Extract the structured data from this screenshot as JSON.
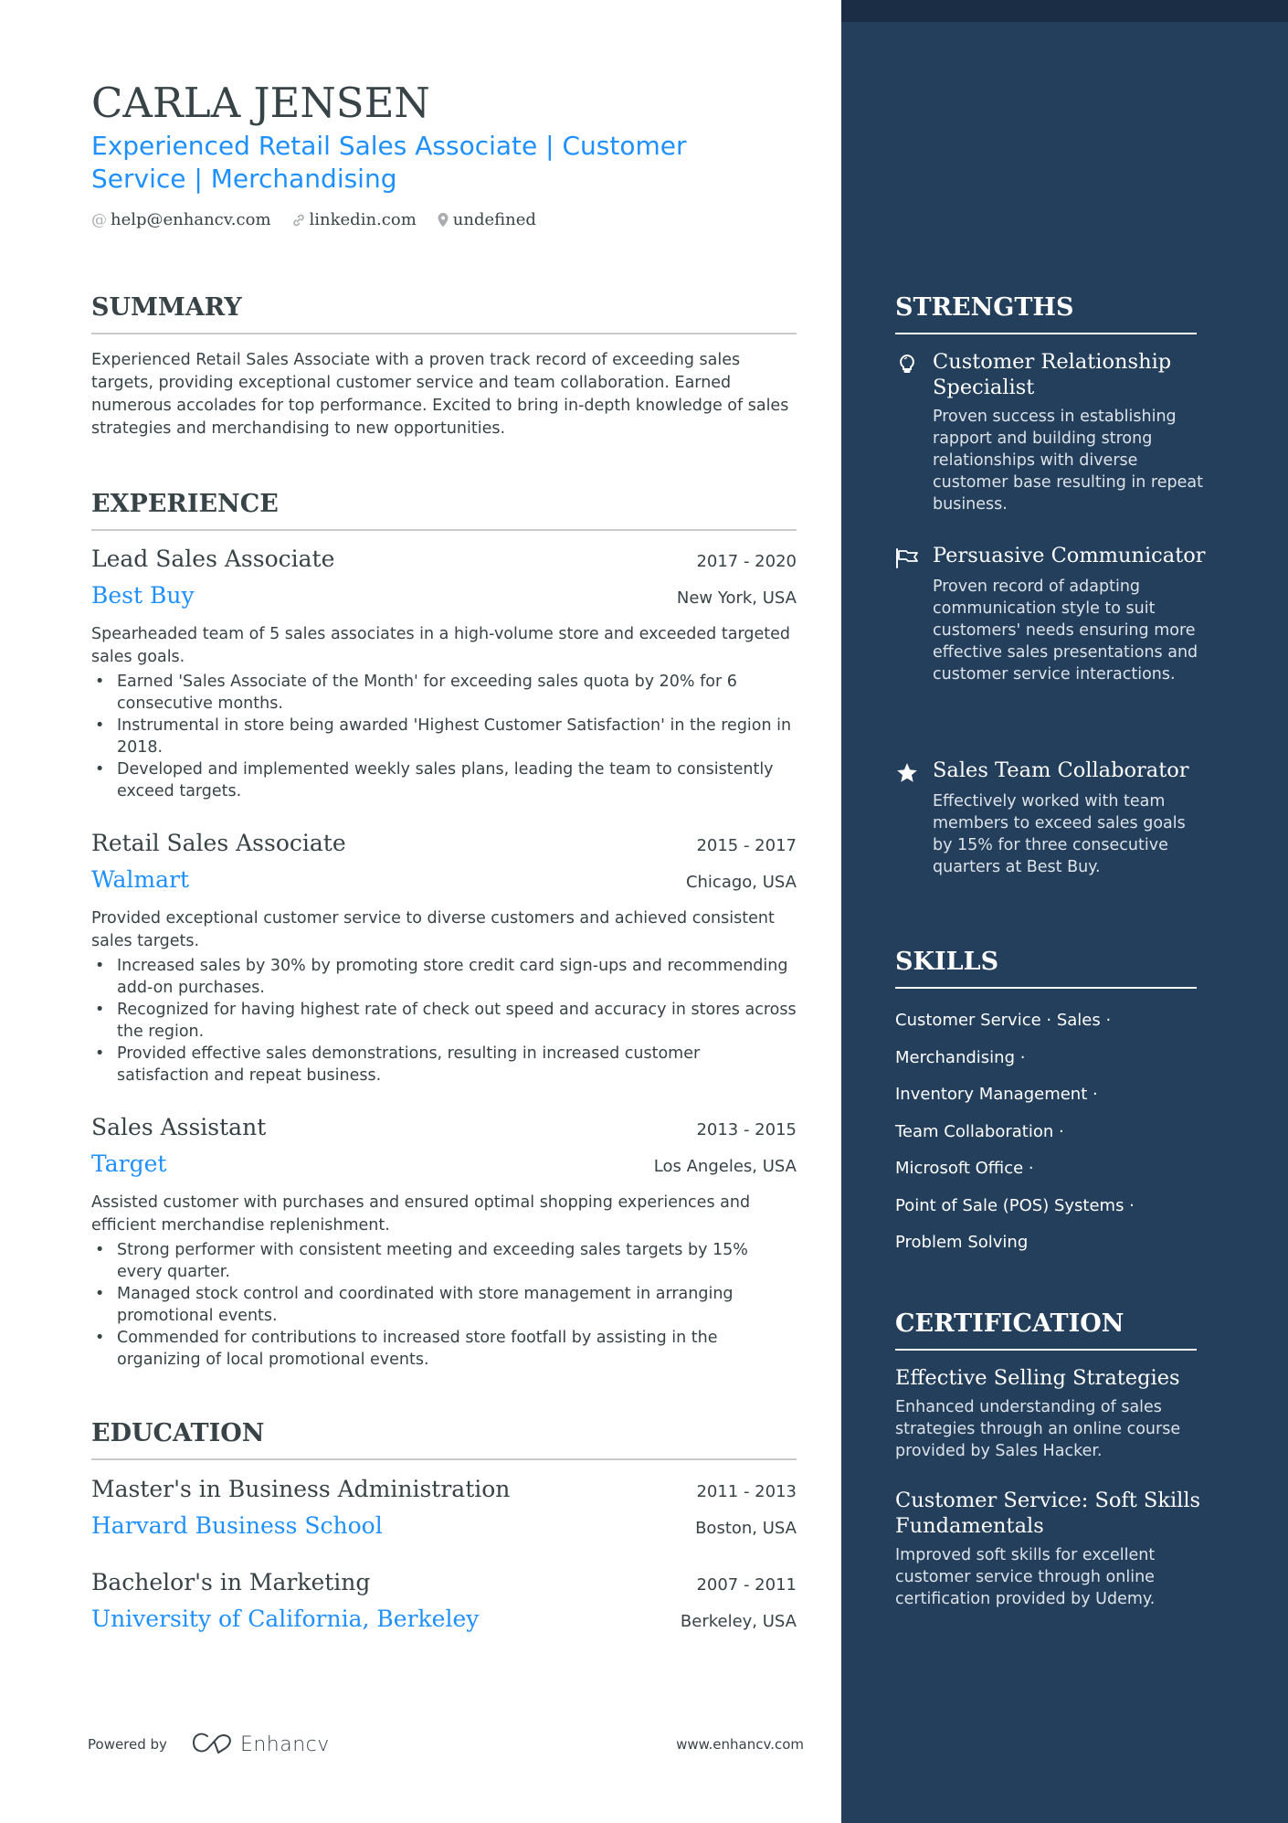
{
  "header": {
    "name": "CARLA JENSEN",
    "headline": "Experienced Retail Sales Associate | Customer Service | Merchandising",
    "contacts": [
      {
        "icon": "at-icon",
        "text": "help@enhancv.com"
      },
      {
        "icon": "link-icon",
        "text": "linkedin.com"
      },
      {
        "icon": "location-pin-icon",
        "text": "undefined"
      }
    ]
  },
  "summary": {
    "title": "SUMMARY",
    "text": "Experienced Retail Sales Associate with a proven track record of exceeding sales targets, providing exceptional customer service and team collaboration. Earned numerous accolades for top performance. Excited to bring in-depth knowledge of sales strategies and merchandising to new opportunities."
  },
  "experience": {
    "title": "EXPERIENCE",
    "items": [
      {
        "role": "Lead Sales Associate",
        "dates": "2017 - 2020",
        "company": "Best Buy",
        "location": "New York, USA",
        "description": "Spearheaded team of 5 sales associates in a high-volume store and exceeded targeted sales goals.",
        "bullets": [
          "Earned 'Sales Associate of the Month' for exceeding sales quota by 20% for 6 consecutive months.",
          "Instrumental in store being awarded 'Highest Customer Satisfaction' in the region in 2018.",
          "Developed and implemented weekly sales plans, leading the team to consistently exceed targets."
        ]
      },
      {
        "role": "Retail Sales Associate",
        "dates": "2015 - 2017",
        "company": "Walmart",
        "location": "Chicago, USA",
        "description": "Provided exceptional customer service to diverse customers and achieved consistent sales targets.",
        "bullets": [
          "Increased sales by 30% by promoting store credit card sign-ups and recommending add-on purchases.",
          "Recognized for having highest rate of check out speed and accuracy in stores across the region.",
          "Provided effective sales demonstrations, resulting in increased customer satisfaction and repeat business."
        ]
      },
      {
        "role": "Sales Assistant",
        "dates": "2013 - 2015",
        "company": "Target",
        "location": "Los Angeles, USA",
        "description": "Assisted customer with purchases and ensured optimal shopping experiences and efficient merchandise replenishment.",
        "bullets": [
          "Strong performer with consistent meeting and exceeding sales targets by 15% every quarter.",
          "Managed stock control and coordinated with store management in arranging promotional events.",
          "Commended for contributions to increased store footfall by assisting in the organizing of local promotional events."
        ]
      }
    ]
  },
  "education": {
    "title": "EDUCATION",
    "items": [
      {
        "degree": "Master's in Business Administration",
        "dates": "2011 - 2013",
        "school": "Harvard Business School",
        "location": "Boston, USA"
      },
      {
        "degree": "Bachelor's in Marketing",
        "dates": "2007 - 2011",
        "school": "University of California, Berkeley",
        "location": "Berkeley, USA"
      }
    ]
  },
  "footer": {
    "powered_by": "Powered by",
    "brand": "Enhancv",
    "website": "www.enhancv.com"
  },
  "strengths": {
    "title": "STRENGTHS",
    "items": [
      {
        "icon": "lightbulb-icon",
        "title": "Customer Relationship Specialist",
        "description": "Proven success in establishing rapport and building strong relationships with diverse customer base resulting in repeat business."
      },
      {
        "icon": "flag-icon",
        "title": "Persuasive Communicator",
        "description": "Proven record of adapting communication style to suit customers' needs ensuring more effective sales presentations and customer service interactions."
      },
      {
        "icon": "star-icon",
        "title": "Sales Team Collaborator",
        "description": "Effectively worked with team members to exceed sales goals by 15% for three consecutive quarters at Best Buy."
      }
    ]
  },
  "skills": {
    "title": "SKILLS",
    "lines": [
      "Customer Service · Sales ·",
      "Merchandising ·",
      "Inventory Management ·",
      "Team Collaboration ·",
      "Microsoft Office ·",
      "Point of Sale (POS) Systems ·",
      "Problem Solving"
    ]
  },
  "certification": {
    "title": "CERTIFICATION",
    "items": [
      {
        "title": "Effective Selling Strategies",
        "description": "Enhanced understanding of sales strategies through an online course provided by Sales Hacker."
      },
      {
        "title": "Customer Service: Soft Skills Fundamentals",
        "description": "Improved soft skills for excellent customer service through online certification provided by Udemy."
      }
    ]
  },
  "colors": {
    "accent": "#1e90ff",
    "text": "#384347",
    "sidebar_bg": "#233f5b",
    "sidebar_topbar": "#1a2d44"
  }
}
